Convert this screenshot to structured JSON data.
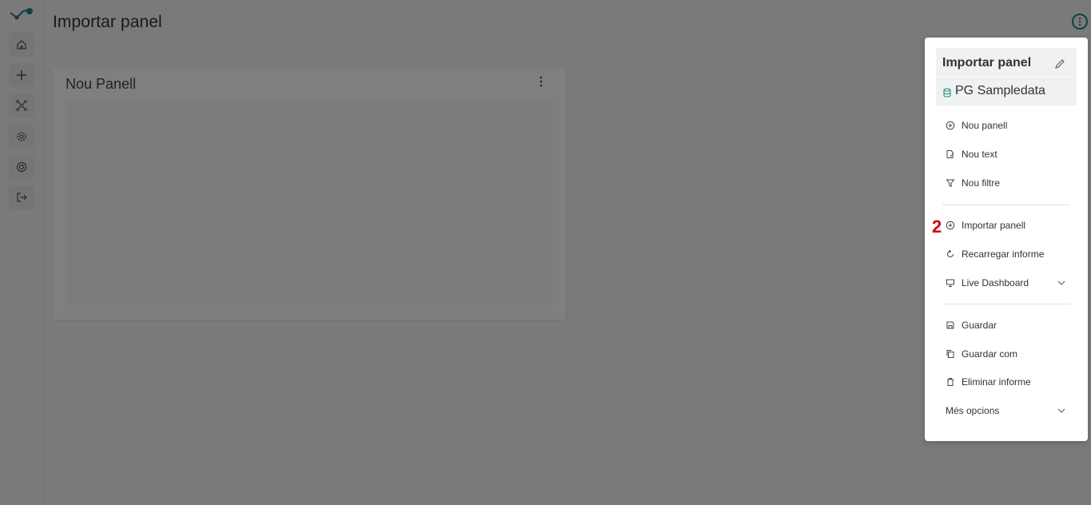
{
  "header": {
    "title": "Importar panel"
  },
  "panel": {
    "title": "Nou Panell"
  },
  "menu": {
    "title": "Importar panel",
    "datasource": "PG Sampledata",
    "group1": [
      {
        "label": "Nou panell",
        "icon": "plus-circle-icon"
      },
      {
        "label": "Nou text",
        "icon": "text-edit-icon"
      },
      {
        "label": "Nou filtre",
        "icon": "filter-icon"
      }
    ],
    "group2": [
      {
        "label": "Importar panell",
        "icon": "plus-circle-icon"
      },
      {
        "label": "Recarregar informe",
        "icon": "refresh-icon"
      },
      {
        "label": "Live Dashboard",
        "icon": "monitor-icon"
      }
    ],
    "group3": [
      {
        "label": "Guardar",
        "icon": "save-icon"
      },
      {
        "label": "Guardar com",
        "icon": "copy-save-icon"
      },
      {
        "label": "Eliminar informe",
        "icon": "trash-icon"
      },
      {
        "label": "Més opcions",
        "icon": ""
      }
    ]
  },
  "annotation": {
    "step": "2"
  },
  "colors": {
    "accent": "#1b8a7e",
    "step_marker": "#d40000",
    "overlay": "rgba(0,0,0,0.5)"
  }
}
